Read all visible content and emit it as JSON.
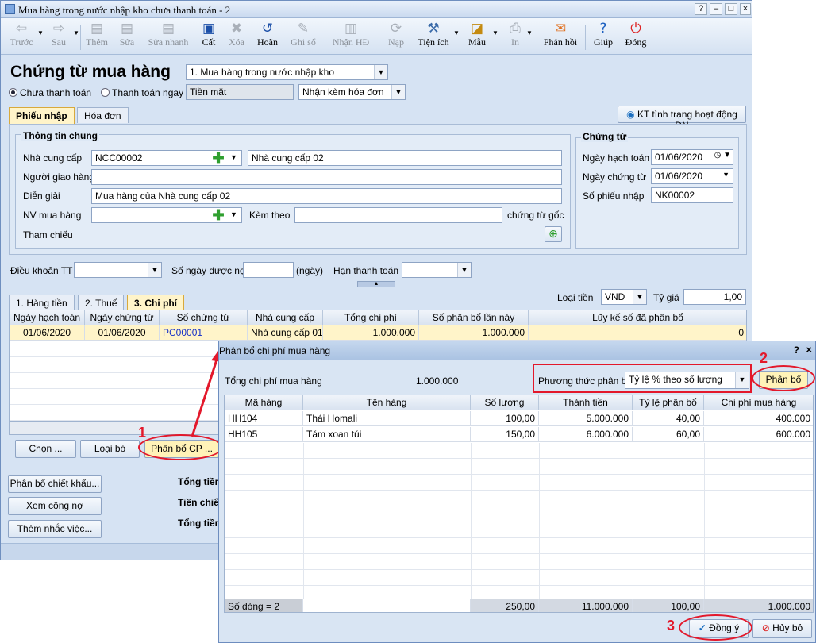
{
  "window": {
    "title": "Mua hàng trong nước nhập kho chưa thanh toán - 2"
  },
  "toolbar": [
    {
      "label": "Trước",
      "icon": "back-arrow-icon",
      "enabled": false
    },
    {
      "label": "Sau",
      "icon": "forward-arrow-icon",
      "enabled": false
    },
    {
      "label": "Thêm",
      "icon": "add-document-icon",
      "enabled": false
    },
    {
      "label": "Sửa",
      "icon": "edit-document-icon",
      "enabled": false
    },
    {
      "label": "Sửa nhanh",
      "icon": "quick-edit-icon",
      "enabled": false
    },
    {
      "label": "Cất",
      "icon": "save-disk-icon",
      "enabled": true
    },
    {
      "label": "Xóa",
      "icon": "delete-icon",
      "enabled": false
    },
    {
      "label": "Hoãn",
      "icon": "undo-icon",
      "enabled": true
    },
    {
      "label": "Ghi sổ",
      "icon": "pencil-icon",
      "enabled": false
    },
    {
      "label": "Nhận HĐ",
      "icon": "invoice-icon",
      "enabled": false
    },
    {
      "label": "Nạp",
      "icon": "reload-icon",
      "enabled": false
    },
    {
      "label": "Tiện ích",
      "icon": "tools-icon",
      "enabled": true
    },
    {
      "label": "Mẫu",
      "icon": "template-icon",
      "enabled": true
    },
    {
      "label": "In",
      "icon": "printer-icon",
      "enabled": false
    },
    {
      "label": "Phản hồi",
      "icon": "feedback-envelope-icon",
      "enabled": true
    },
    {
      "label": "Giúp",
      "icon": "help-icon",
      "enabled": true
    },
    {
      "label": "Đóng",
      "icon": "close-power-icon",
      "enabled": true
    }
  ],
  "header": {
    "title": "Chứng từ mua hàng",
    "type_select": "1. Mua hàng trong nước nhập kho",
    "payment_unpaid": "Chưa thanh toán",
    "payment_paid": "Thanh toán ngay",
    "payment_method": "Tiền mặt",
    "invoice_select": "Nhận kèm hóa đơn"
  },
  "tabs": {
    "receipt": "Phiếu nhập",
    "invoice": "Hóa đơn",
    "kt_button": "KT tình trạng hoạt động DN"
  },
  "general": {
    "section": "Thông tin chung",
    "supplier_label": "Nhà cung cấp",
    "supplier_code": "NCC00002",
    "supplier_name": "Nhà cung cấp 02",
    "deliverer_label": "Người giao hàng",
    "deliverer": "",
    "desc_label": "Diễn giải",
    "desc": "Mua hàng của Nhà cung cấp 02",
    "buyer_label": "NV mua hàng",
    "attach_label": "Kèm theo",
    "original_docs": "chứng từ gốc",
    "ref_label": "Tham chiếu"
  },
  "voucher": {
    "section": "Chứng từ",
    "post_date_label": "Ngày hạch toán",
    "post_date": "01/06/2020",
    "doc_date_label": "Ngày chứng từ",
    "doc_date": "01/06/2020",
    "number_label": "Số phiếu nhập",
    "number": "NK00002"
  },
  "terms": {
    "label": "Điều khoản TT",
    "days_label": "Số ngày được nợ",
    "days_unit": "(ngày)",
    "due_label": "Hạn thanh toán"
  },
  "currency": {
    "label": "Loại tiền",
    "value": "VND",
    "rate_label": "Tỷ giá",
    "rate": "1,00"
  },
  "detail_tabs": [
    "1. Hàng tiền",
    "2. Thuế",
    "3. Chi phí"
  ],
  "cost_grid": {
    "columns": [
      "Ngày hạch toán",
      "Ngày chứng từ",
      "Số chứng từ",
      "Nhà cung cấp",
      "Tổng chi phí",
      "Số phân bổ lần này",
      "Lũy kế số đã phân bổ"
    ],
    "rows": [
      [
        "01/06/2020",
        "01/06/2020",
        "PC00001",
        "Nhà cung cấp 01",
        "1.000.000",
        "1.000.000",
        "0"
      ]
    ]
  },
  "grid_buttons": {
    "choose": "Chọn ...",
    "remove": "Loại bỏ",
    "allocate": "Phân bổ CP ..."
  },
  "side_buttons": [
    "Phân bổ chiết khấu...",
    "Xem công nợ",
    "Thêm nhắc việc..."
  ],
  "totals_labels": [
    "Tổng tiền",
    "Tiền chiế",
    "Tổng tiền"
  ],
  "dialog": {
    "title": "Phân bổ chi phí mua hàng",
    "total_label": "Tổng chi phí mua hàng",
    "total": "1.000.000",
    "method_label": "Phương thức phân bổ",
    "method": "Tỷ lệ % theo số lượng",
    "allocate_btn": "Phân bổ",
    "columns": [
      "Mã hàng",
      "Tên hàng",
      "Số lượng",
      "Thành tiền",
      "Tỷ lệ phân bổ",
      "Chi phí mua hàng"
    ],
    "rows": [
      [
        "HH104",
        "Thái Homali",
        "100,00",
        "5.000.000",
        "40,00",
        "400.000"
      ],
      [
        "HH105",
        "Tám xoan túi",
        "150,00",
        "6.000.000",
        "60,00",
        "600.000"
      ]
    ],
    "footer": [
      "Số dòng = 2",
      "",
      "250,00",
      "11.000.000",
      "100,00",
      "1.000.000"
    ],
    "ok": "Đồng ý",
    "cancel": "Hủy bỏ",
    "help": "?",
    "close": "×"
  },
  "annotations": [
    "1",
    "2",
    "3"
  ],
  "colors": {
    "highlight": "#e3182b",
    "active_tab": "#fff4c9"
  }
}
